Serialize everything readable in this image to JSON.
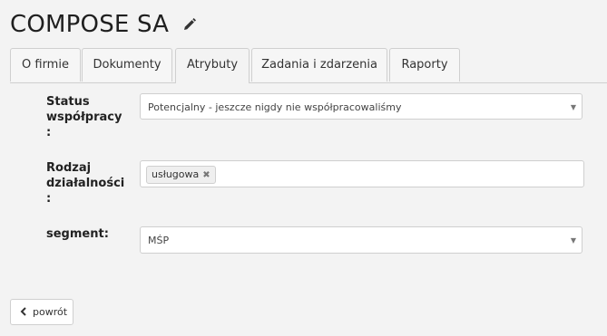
{
  "header": {
    "title": "COMPOSE SA"
  },
  "tabs": [
    {
      "label": "O firmie"
    },
    {
      "label": "Dokumenty"
    },
    {
      "label": "Atrybuty"
    },
    {
      "label": "Zadania i zdarzenia"
    },
    {
      "label": "Raporty"
    }
  ],
  "active_tab": "Atrybuty",
  "form": {
    "status": {
      "label_line1": "Status",
      "label_line2": "współpracy",
      "label_line3": ":",
      "value": "Potencjalny - jeszcze nigdy nie współpracowaliśmy"
    },
    "activity": {
      "label_line1": "Rodzaj",
      "label_line2": "działalności",
      "label_line3": ":",
      "tags": [
        "usługowa"
      ],
      "remove_symbol": "✖"
    },
    "segment": {
      "label": "segment:",
      "value": "MŚP"
    }
  },
  "footer": {
    "back_label": "powrót"
  },
  "icons": {
    "edit": "pencil-icon",
    "caret": "caret-down-icon",
    "back": "chevron-left-icon"
  },
  "colors": {
    "background": "#f3f3f3",
    "border": "#cfcfcf"
  }
}
